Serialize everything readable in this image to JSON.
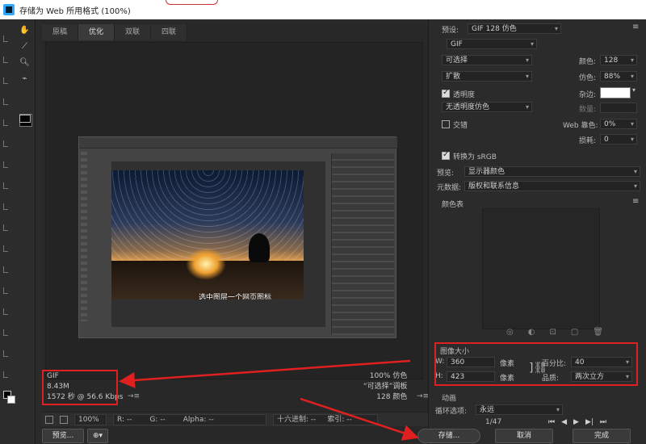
{
  "window": {
    "title": "存储为 Web 所用格式 (100%)"
  },
  "tabs": [
    "原稿",
    "优化",
    "双联",
    "四联"
  ],
  "preview": {
    "caption": "选中图层一个网页图标"
  },
  "info_left": {
    "format": "GIF",
    "size": "8.43M",
    "time": "1572 秒 @ 56.6 Kbps"
  },
  "info_right": {
    "dither": "100% 仿色",
    "palette": "“可选择”调板",
    "colors": "128 颜色"
  },
  "status_bar": {
    "zoom": "100%",
    "r": "R: --",
    "g": "G: --",
    "alpha": "Alpha: --",
    "hex": "十六进制: --",
    "index": "索引: --"
  },
  "right_panel": {
    "preset_label": "预设:",
    "preset_value": "GIF 128 仿色",
    "format": "GIF",
    "reduction": "可选择",
    "dither_algo": "扩散",
    "colors_label": "颜色:",
    "colors_value": "128",
    "dither_label": "仿色:",
    "dither_value": "88%",
    "transparency_label": "透明度",
    "matte_label": "杂边:",
    "matte_value": "",
    "trans_dither": "无透明度仿色",
    "amount_label": "数量:",
    "interlaced_label": "交错",
    "web_snap_label": "Web 靠色:",
    "web_snap_value": "0%",
    "lossy_label": "损耗:",
    "lossy_value": "0",
    "srgb_label": "转换为 sRGB",
    "preview_label": "预览:",
    "preview_value": "显示器颜色",
    "metadata_label": "元数据:",
    "metadata_value": "版权和联系信息",
    "color_table_label": "颜色表",
    "image_size_title": "图像大小",
    "w_label": "W:",
    "w_value": "360",
    "h_label": "H:",
    "h_value": "423",
    "unit": "像素",
    "percent_label": "百分比:",
    "percent_value": "40",
    "quality_label": "品质:",
    "quality_value": "两次立方",
    "animation_label": "动画",
    "loop_label": "循环选项:",
    "loop_value": "永远",
    "frame_info": "1/47"
  },
  "buttons": {
    "preview": "预览...",
    "save": "存储...",
    "cancel": "取消",
    "done": "完成"
  },
  "accent": "#e02020"
}
